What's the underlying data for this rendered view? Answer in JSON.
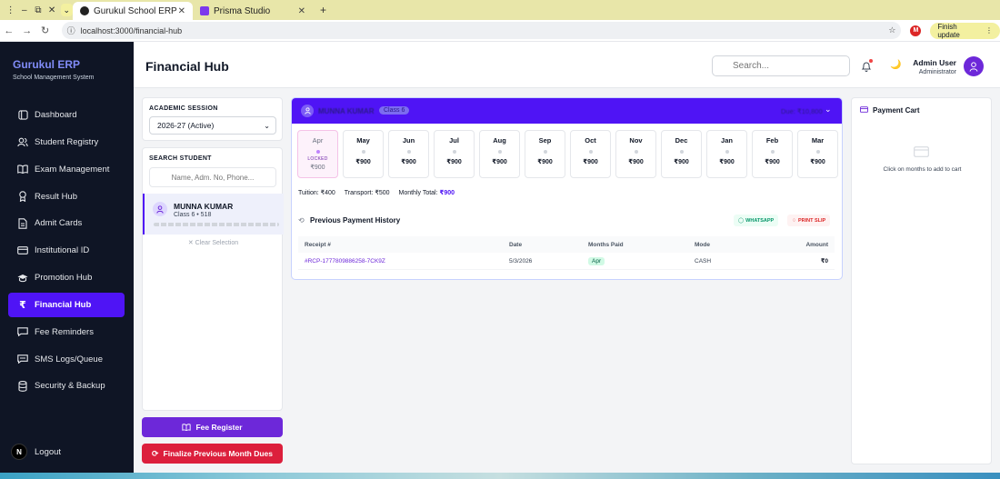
{
  "browser": {
    "tabs": [
      {
        "title": "Gurukul School ERP",
        "active": true
      },
      {
        "title": "Prisma Studio",
        "active": false
      }
    ],
    "url": "localhost:3000/financial-hub",
    "finish_update": "Finish update",
    "profile_initial": "M"
  },
  "sidebar": {
    "brand_title": "Gurukul ERP",
    "brand_subtitle": "School Management System",
    "items": [
      {
        "label": "Dashboard",
        "icon": "grid-icon",
        "active": false
      },
      {
        "label": "Student Registry",
        "icon": "users-icon",
        "active": false
      },
      {
        "label": "Exam Management",
        "icon": "book-open-icon",
        "active": false
      },
      {
        "label": "Result Hub",
        "icon": "award-icon",
        "active": false
      },
      {
        "label": "Admit Cards",
        "icon": "file-icon",
        "active": false
      },
      {
        "label": "Institutional ID",
        "icon": "id-card-icon",
        "active": false
      },
      {
        "label": "Promotion Hub",
        "icon": "graduation-cap-icon",
        "active": false
      },
      {
        "label": "Financial Hub",
        "icon": "rupee-icon",
        "active": true
      },
      {
        "label": "Fee Reminders",
        "icon": "message-icon",
        "active": false
      },
      {
        "label": "SMS Logs/Queue",
        "icon": "chat-icon",
        "active": false
      },
      {
        "label": "Security & Backup",
        "icon": "database-icon",
        "active": false
      }
    ],
    "logout_label": "Logout",
    "logout_initial": "N"
  },
  "header": {
    "title": "Financial Hub",
    "search_placeholder": "Search...",
    "user_name": "Admin User",
    "user_role": "Administrator",
    "theme_icon": "🌙"
  },
  "session": {
    "label": "ACADEMIC SESSION",
    "selected": "2026-27 (Active)"
  },
  "student_search": {
    "label": "SEARCH STUDENT",
    "placeholder": "Name, Adm. No, Phone...",
    "result_name": "MUNNA KUMAR",
    "result_class": "Class 6 • 518",
    "clear_label": "✕ Clear Selection"
  },
  "buttons": {
    "fee_register": "Fee Register",
    "finalize_dues": "Finalize Previous Month Dues"
  },
  "student_card": {
    "name": "MUNNA KUMAR",
    "class_badge": "Class 6",
    "due_text": "Due: ₹10,800"
  },
  "months": [
    {
      "name": "Apr",
      "locked": true,
      "lock_label": "LOCKED",
      "amount": "₹900"
    },
    {
      "name": "May",
      "locked": false,
      "amount": "₹900"
    },
    {
      "name": "Jun",
      "locked": false,
      "amount": "₹900"
    },
    {
      "name": "Jul",
      "locked": false,
      "amount": "₹900"
    },
    {
      "name": "Aug",
      "locked": false,
      "amount": "₹900"
    },
    {
      "name": "Sep",
      "locked": false,
      "amount": "₹900"
    },
    {
      "name": "Oct",
      "locked": false,
      "amount": "₹900"
    },
    {
      "name": "Nov",
      "locked": false,
      "amount": "₹900"
    },
    {
      "name": "Dec",
      "locked": false,
      "amount": "₹900"
    },
    {
      "name": "Jan",
      "locked": false,
      "amount": "₹900"
    },
    {
      "name": "Feb",
      "locked": false,
      "amount": "₹900"
    },
    {
      "name": "Mar",
      "locked": false,
      "amount": "₹900"
    }
  ],
  "fees": {
    "tuition": "Tuition: ₹400",
    "transport": "Transport: ₹500",
    "monthly_label": "Monthly Total: ",
    "monthly_total": "₹900"
  },
  "history": {
    "title": "Previous Payment History",
    "whatsapp": "WHATSAPP",
    "print_slip": "PRINT SLIP",
    "columns": [
      "Receipt #",
      "Date",
      "Months Paid",
      "Mode",
      "Amount"
    ],
    "rows": [
      {
        "receipt": "#RCP-1777809886258-7CK9Z",
        "date": "5/3/2026",
        "months": "Apr",
        "mode": "CASH",
        "amount": "₹0"
      }
    ]
  },
  "cart": {
    "title": "Payment Cart",
    "empty_text": "Click on months to add to cart"
  },
  "colors": {
    "accent": "#4f14f5",
    "sidebar_bg": "#0f1525",
    "danger": "#dc1f3c",
    "purple_button": "#6d28d9"
  }
}
